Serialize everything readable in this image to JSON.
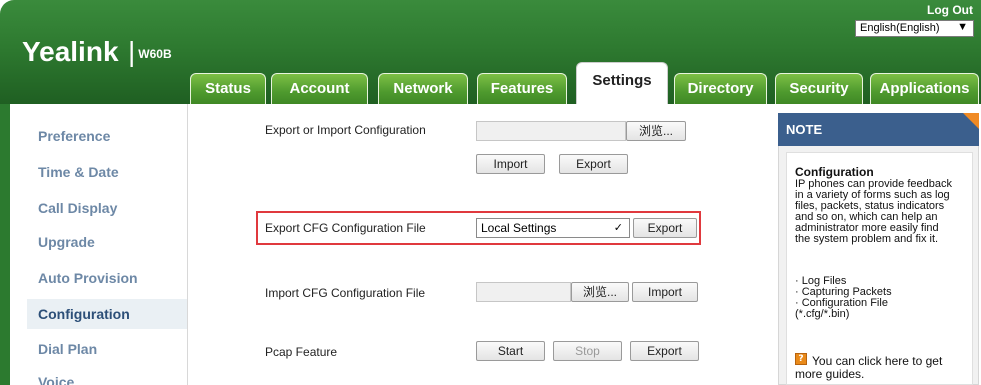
{
  "header": {
    "brand": "Yealink",
    "model": "W60B",
    "logout": "Log Out",
    "language": "English(English)"
  },
  "tabs": [
    {
      "label": "Status",
      "active": false
    },
    {
      "label": "Account",
      "active": false
    },
    {
      "label": "Network",
      "active": false
    },
    {
      "label": "Features",
      "active": false
    },
    {
      "label": "Settings",
      "active": true
    },
    {
      "label": "Directory",
      "active": false
    },
    {
      "label": "Security",
      "active": false
    },
    {
      "label": "Applications",
      "active": false
    }
  ],
  "sidebar": {
    "items": [
      {
        "label": "Preference"
      },
      {
        "label": "Time & Date"
      },
      {
        "label": "Call Display"
      },
      {
        "label": "Upgrade"
      },
      {
        "label": "Auto Provision"
      },
      {
        "label": "Configuration",
        "active": true
      },
      {
        "label": "Dial Plan"
      },
      {
        "label": "Voice"
      }
    ]
  },
  "main": {
    "export_import": {
      "label": "Export or Import Configuration",
      "browse": "浏览...",
      "import": "Import",
      "export": "Export"
    },
    "export_cfg": {
      "label": "Export CFG Configuration File",
      "selected": "Local Settings",
      "export": "Export"
    },
    "import_cfg": {
      "label": "Import CFG Configuration File",
      "browse": "浏览...",
      "import": "Import"
    },
    "pcap": {
      "label": "Pcap Feature",
      "start": "Start",
      "stop": "Stop",
      "export": "Export"
    }
  },
  "note": {
    "title": "NOTE",
    "heading": "Configuration",
    "lines": [
      "IP phones can provide feedback",
      "in a variety of forms such as log",
      "files, packets, status indicators",
      "and so on, which can help an",
      "administrator more easily find",
      "the system problem and fix it."
    ],
    "bullets": [
      "· Log Files",
      "· Capturing Packets",
      "· Configuration File",
      "(*.cfg/*.bin)"
    ],
    "guide_line1": "You can click here to get",
    "guide_line2": "more guides."
  },
  "colors": {
    "header_green": "#2e7a30",
    "tab_green": "#4e9a2e",
    "note_blue": "#3b5f8d",
    "note_corner": "#f08a24",
    "highlight": "#e0393e",
    "nav_text": "#6d88a6"
  }
}
